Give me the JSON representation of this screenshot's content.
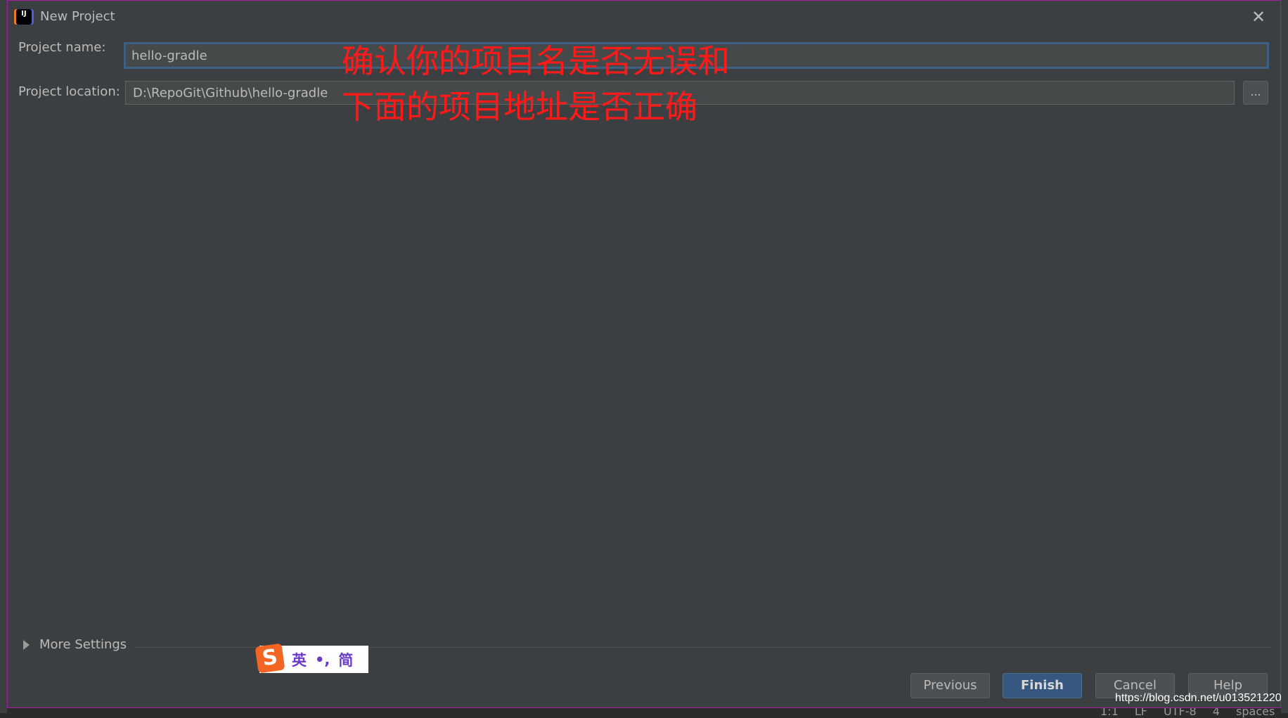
{
  "window": {
    "title": "New Project",
    "icon": "intellij-idea-icon",
    "close_icon": "close-icon"
  },
  "form": {
    "project_name_label": "Project name:",
    "project_name_value": "hello-gradle",
    "project_location_label": "Project location:",
    "project_location_value": "D:\\RepoGit\\Github\\hello-gradle",
    "browse_label": "..."
  },
  "annotation": {
    "line1": "确认你的项目名是否无误和",
    "line2": "下面的项目地址是否正确",
    "color": "#ff1a1a"
  },
  "more_settings": {
    "label": "More Settings"
  },
  "ime": {
    "logo": "S",
    "mode": "英",
    "punct": "•,",
    "script": "简"
  },
  "buttons": {
    "previous": "Previous",
    "finish": "Finish",
    "cancel": "Cancel",
    "help": "Help"
  },
  "watermark": "https://blog.csdn.net/u013521220",
  "status_bar": "1:1 LF UTF-8 4 spaces",
  "colors": {
    "background": "#3c3f41",
    "primary_button": "#365880",
    "focus_border": "#3d6185"
  }
}
